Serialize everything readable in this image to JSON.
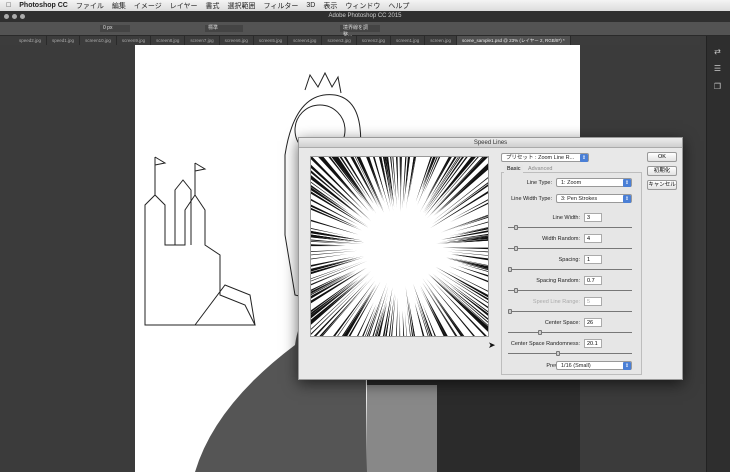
{
  "menubar": {
    "apple": "",
    "items": [
      "Photoshop CC",
      "ファイル",
      "編集",
      "イメージ",
      "レイヤー",
      "書式",
      "選択範囲",
      "フィルター",
      "3D",
      "表示",
      "ウィンドウ",
      "ヘルプ"
    ]
  },
  "window": {
    "title": "Adobe Photoshop CC 2015"
  },
  "options": {
    "feather": "0 px",
    "style": "標準",
    "refine": "境界線を調整..."
  },
  "tabs": [
    "speed2.jpg",
    "speed1.jpg",
    "screen10.jpg",
    "screen9.jpg",
    "screen8.jpg",
    "screen7.jpg",
    "screen6.jpg",
    "screen5.jpg",
    "screen4.jpg",
    "screen3.jpg",
    "screen2.jpg",
    "screen1.jpg",
    "screen.jpg",
    "scene_sample1.psd @ 23% (レイヤー 2, RGB/8*) *"
  ],
  "dialog": {
    "title": "Speed Lines",
    "preset": "プリセット : Zoom Line R...",
    "tabs": [
      "Basic",
      "Advanced"
    ],
    "buttons": {
      "ok": "OK",
      "reset": "初期化",
      "cancel": "キャンセル"
    },
    "line_type": {
      "label": "Line Type:",
      "value": "1: Zoom"
    },
    "line_width_type": {
      "label": "Line Width Type:",
      "value": "3: Pen Strokes"
    },
    "fields": [
      {
        "label": "Line Width:",
        "value": "3",
        "slider": 0.05,
        "disabled": false
      },
      {
        "label": "Width Random:",
        "value": "4",
        "slider": 0.05,
        "disabled": false
      },
      {
        "label": "Spacing:",
        "value": "1",
        "slider": 0.0,
        "disabled": false
      },
      {
        "label": "Spacing Random:",
        "value": "0.7",
        "slider": 0.05,
        "disabled": false
      },
      {
        "label": "Speed Line Range:",
        "value": "5",
        "slider": 0.0,
        "disabled": true
      },
      {
        "label": "Center Space:",
        "value": "26",
        "slider": 0.25,
        "disabled": false
      },
      {
        "label": "Center Space Randomness:",
        "value": "20.1",
        "slider": 0.4,
        "disabled": false
      }
    ],
    "preview_zoom": {
      "label": "Preview Zoom:",
      "value": "1/16 (Small)"
    }
  },
  "colors": {
    "accent": "#4a7fd6",
    "workspace": "#3b3b3b"
  }
}
